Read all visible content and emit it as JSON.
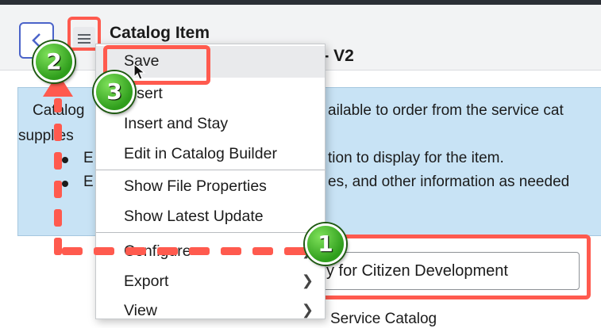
{
  "header": {
    "title": "Catalog Item",
    "subtitle": "ent - V2"
  },
  "info": {
    "line1_left": "Catalog",
    "line1_right": "ailable to order from the service cat",
    "line2_left": "supplies",
    "bullet1_left": "E",
    "bullet1_right": "tion to display for the item.",
    "bullet2_left": "E",
    "bullet2_right": "es, and other information as needed"
  },
  "menu": {
    "items": [
      {
        "label": "Save"
      },
      {
        "label": "Insert"
      },
      {
        "label": "Insert and Stay"
      },
      {
        "label": "Edit in Catalog Builder"
      },
      {
        "label": "Show File Properties"
      },
      {
        "label": "Show Latest Update"
      },
      {
        "label": "Configure"
      },
      {
        "label": "Export"
      },
      {
        "label": "View"
      }
    ]
  },
  "form": {
    "name_value": "y for Citizen Development",
    "below_text": "Service Catalog"
  },
  "annotations": {
    "step1": "1",
    "step2": "2",
    "step3": "3",
    "highlight_color": "#ff5a4e",
    "badge_color": "#3dab22"
  }
}
